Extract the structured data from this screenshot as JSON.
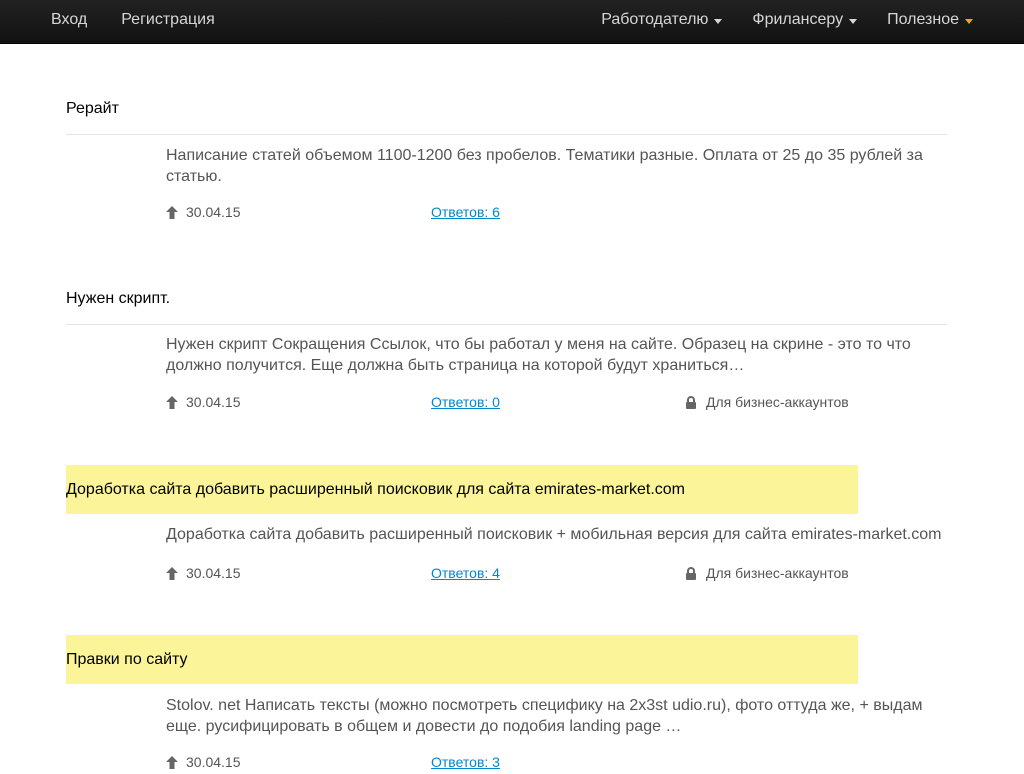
{
  "nav": {
    "login": "Вход",
    "register": "Регистрация",
    "employer": "Работодателю",
    "freelancer": "Фрилансеру",
    "useful": "Полезное"
  },
  "colors": {
    "navbar": "#1b1b1b",
    "highlight": "#fbf499",
    "link": "#0088cc",
    "accent_caret": "#f4a31c"
  },
  "jobs": [
    {
      "title": "Рерайт",
      "description": "Написание статей объемом 1100-1200 без пробелов. Тематики разные. Оплата от 25 до 35 рублей за статью.",
      "date": "30.04.15",
      "answers": "Ответов: 6",
      "business_only": "",
      "highlighted": false
    },
    {
      "title": "Нужен скрипт.",
      "description": "Нужен скрипт Сокращения Ссылок, что бы работал у меня на сайте. Образец на скрине - это то что должно получится. Еще должна быть страница на которой будут храниться…",
      "date": "30.04.15",
      "answers": "Ответов: 0",
      "business_only": "Для бизнес-аккаунтов",
      "highlighted": false
    },
    {
      "title": "Доработка сайта добавить расширенный поисковик для сайта emirates-market.com",
      "description": "Доработка сайта добавить расширенный поисковик + мобильная версия для сайта emirates-market.com",
      "date": "30.04.15",
      "answers": "Ответов: 4",
      "business_only": "Для бизнес-аккаунтов",
      "highlighted": true
    },
    {
      "title": "Правки по сайту",
      "description": "Stolov. net Написать тексты (можно посмотреть специфику на 2х3st udio.ru), фото оттуда же, + выдам еще. русифицировать в общем и довести до подобия landing page …",
      "date": "30.04.15",
      "answers": "Ответов: 3",
      "business_only": "",
      "highlighted": true
    }
  ]
}
